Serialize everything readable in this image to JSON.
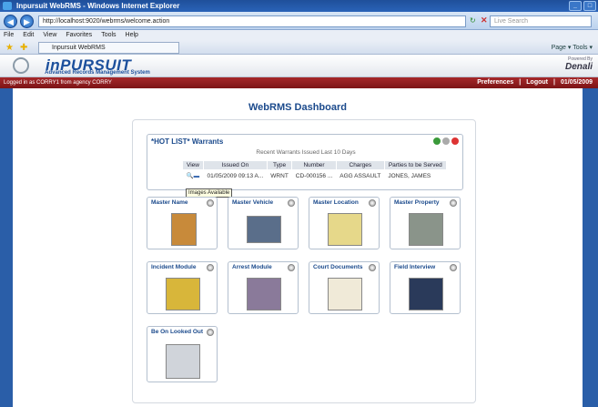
{
  "window": {
    "title": "Inpursuit WebRMS - Windows Internet Explorer"
  },
  "browser": {
    "url": "http://localhost:9020/webrms/welcome.action",
    "search_placeholder": "Live Search",
    "menu": [
      "File",
      "Edit",
      "View",
      "Favorites",
      "Tools",
      "Help"
    ],
    "tab": "Inpursuit WebRMS",
    "tools": "Page ▾  Tools ▾"
  },
  "header": {
    "logo": "inPURSUIT",
    "logo_sub": "Advanced Records Management System",
    "powered": "Powered By",
    "partner": "Denali"
  },
  "userbar": {
    "logged_in": "Logged in as CORRY1 from agency CORRY",
    "preferences": "Preferences",
    "logout": "Logout",
    "date": "01/05/2009"
  },
  "dashboard": {
    "title": "WebRMS Dashboard"
  },
  "hotlist": {
    "title": "*HOT LIST* Warrants",
    "subtitle": "Recent Warrants Issued Last 10 Days",
    "columns": [
      "View",
      "Issued On",
      "Type",
      "Number",
      "Charges",
      "Parties to be Served"
    ],
    "rows": [
      {
        "issued": "01/05/2009 09:13 A...",
        "type": "WRNT",
        "number": "CD-000156 ...",
        "charges": "AGG ASSAULT",
        "parties": "JONES, JAMES"
      }
    ],
    "tooltip": "Images Available"
  },
  "modules": [
    {
      "label": "Master Name",
      "icon": "address-book-icon"
    },
    {
      "label": "Master Vehicle",
      "icon": "car-icon"
    },
    {
      "label": "Master Location",
      "icon": "map-icon"
    },
    {
      "label": "Master Property",
      "icon": "shelves-icon"
    },
    {
      "label": "Incident Module",
      "icon": "police-line-icon"
    },
    {
      "label": "Arrest Module",
      "icon": "arrest-icon"
    },
    {
      "label": "Court Documents",
      "icon": "scales-icon"
    },
    {
      "label": "Field Interview",
      "icon": "officers-icon"
    },
    {
      "label": "Be On Looked Out",
      "icon": "scanner-icon"
    }
  ]
}
